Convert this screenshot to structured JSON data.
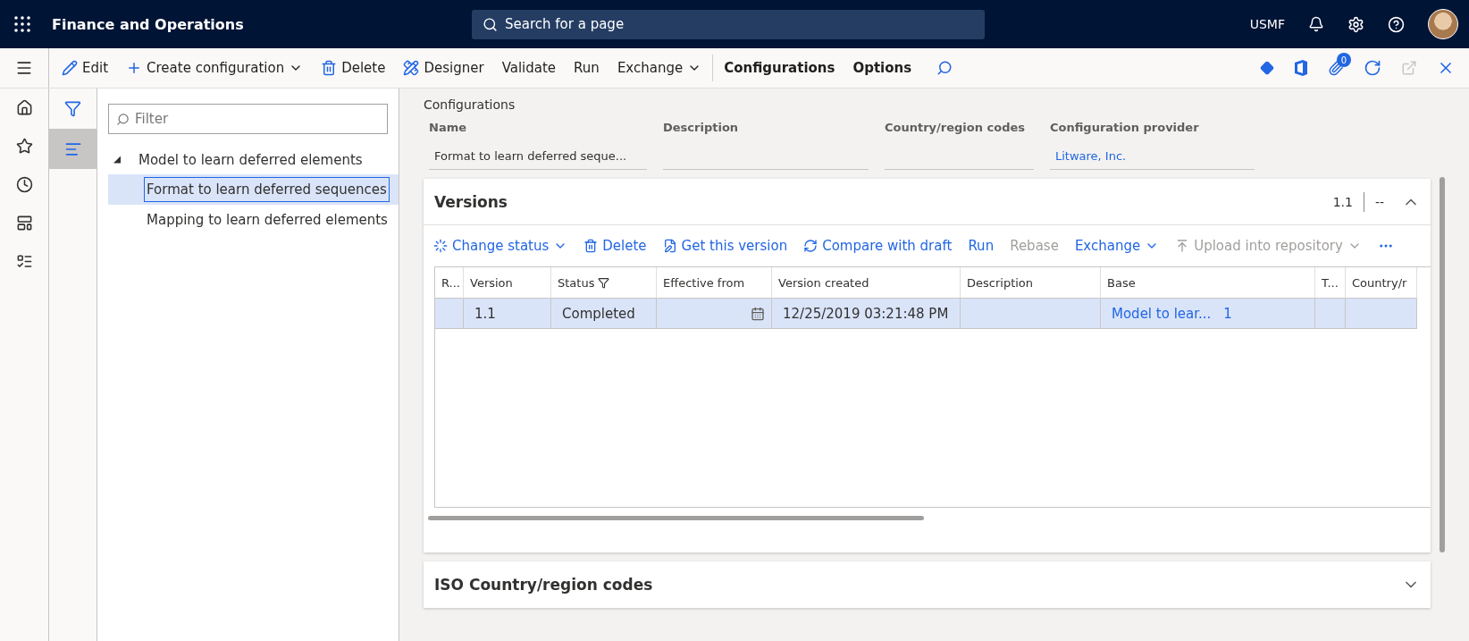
{
  "app": {
    "title": "Finance and Operations",
    "search_placeholder": "Search for a page",
    "company": "USMF",
    "attachments_count": "0"
  },
  "toolbar": [
    {
      "label": "Edit",
      "kind": "action"
    },
    {
      "label": "Create configuration",
      "kind": "menu"
    },
    {
      "label": "Delete",
      "kind": "action"
    },
    {
      "label": "Designer",
      "kind": "action"
    },
    {
      "label": "Validate",
      "kind": "action"
    },
    {
      "label": "Run",
      "kind": "action"
    },
    {
      "label": "Exchange",
      "kind": "menu"
    },
    {
      "label": "Configurations",
      "kind": "group"
    },
    {
      "label": "Options",
      "kind": "group"
    }
  ],
  "filter": {
    "placeholder": "Filter"
  },
  "tree": [
    {
      "label": "Model to learn deferred elements",
      "expanded": true,
      "children": [
        {
          "label": "Format to learn deferred sequences",
          "selected": true
        },
        {
          "label": "Mapping to learn deferred elements",
          "selected": false
        }
      ]
    }
  ],
  "section_title": "Configurations",
  "fields": [
    {
      "label": "Name",
      "value": "Format to learn deferred seque...",
      "kind": "text"
    },
    {
      "label": "Description",
      "kind": "text"
    },
    {
      "label": "Country/region codes",
      "kind": "text"
    },
    {
      "label": "Configuration provider",
      "value": "Litware, Inc.",
      "kind": "link"
    }
  ],
  "versions": {
    "title": "Versions",
    "version": "1.1",
    "status": "--",
    "expanded": true,
    "actions": [
      {
        "label": "Change status",
        "dropdown": true,
        "disabled": false
      },
      {
        "label": "Delete",
        "dropdown": false,
        "disabled": false
      },
      {
        "label": "Get this version",
        "dropdown": false,
        "disabled": false
      },
      {
        "label": "Compare with draft",
        "dropdown": false,
        "disabled": false
      },
      {
        "label": "Run",
        "dropdown": false,
        "disabled": false
      },
      {
        "label": "Rebase",
        "dropdown": false,
        "disabled": true
      },
      {
        "label": "Exchange",
        "dropdown": true,
        "disabled": false
      },
      {
        "label": "Upload into repository",
        "dropdown": true,
        "disabled": true
      }
    ],
    "columns": [
      {
        "label": "R...",
        "filtered": false
      },
      {
        "label": "Version",
        "filtered": false
      },
      {
        "label": "Status",
        "filtered": true
      },
      {
        "label": "Effective from",
        "filtered": false
      },
      {
        "label": "Version created",
        "filtered": false
      },
      {
        "label": "Description",
        "filtered": false
      },
      {
        "label": "Base",
        "filtered": false
      },
      {
        "label": "T...",
        "filtered": false
      },
      {
        "label": "Country/r",
        "filtered": false
      }
    ],
    "rows": [
      {
        "selected": true,
        "version": "1.1",
        "status": "Completed",
        "created": "12/25/2019 03:21:48 PM",
        "base": "Model to lear...",
        "base_version": "1"
      }
    ]
  },
  "iso_section": {
    "title": "ISO Country/region codes",
    "expanded": false
  }
}
